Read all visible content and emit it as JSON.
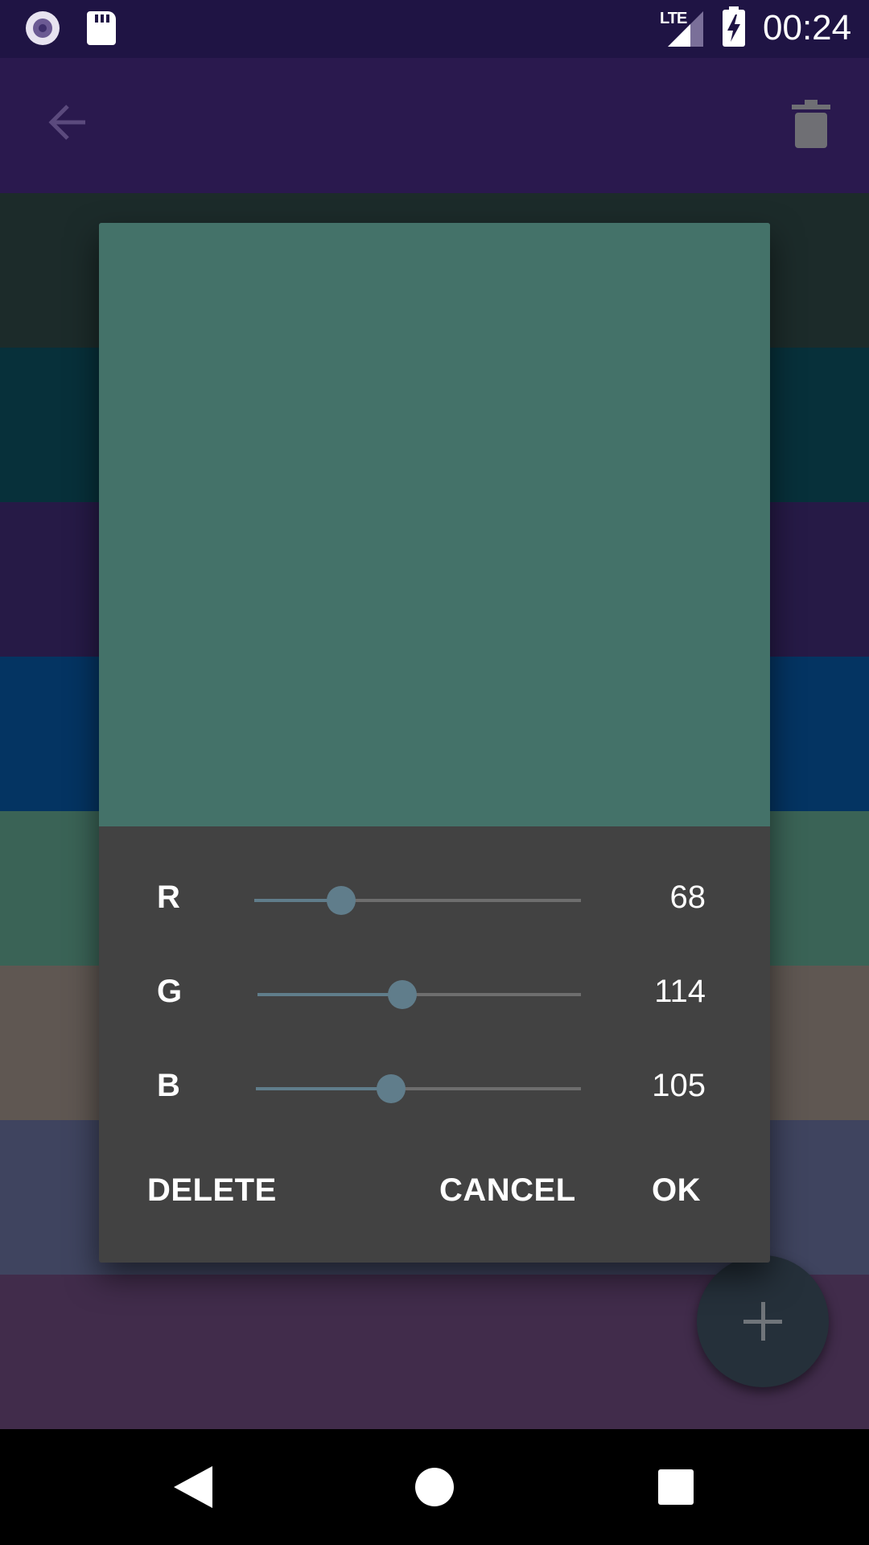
{
  "status_bar": {
    "network": "LTE",
    "time": "00:24"
  },
  "app_bar": {
    "icons": [
      "back-arrow-icon",
      "trash-icon"
    ]
  },
  "background_list": {
    "stripe_colors": [
      "#1c2b2a",
      "#07303a",
      "#261a46",
      "#043462",
      "#3a6356",
      "#5f5752",
      "#3f445f",
      "#412c4b"
    ]
  },
  "dialog": {
    "preview_color": "#447269",
    "sliders": [
      {
        "label": "R",
        "value": "68",
        "fraction": 0.267
      },
      {
        "label": "G",
        "value": "114",
        "fraction": 0.447
      },
      {
        "label": "B",
        "value": "105",
        "fraction": 0.412
      }
    ],
    "buttons": {
      "delete": "DELETE",
      "cancel": "CANCEL",
      "ok": "OK"
    },
    "accent_color": "#607d8b"
  },
  "fab": {
    "icon": "plus-icon"
  },
  "nav_bar": {
    "icons": [
      "nav-back-icon",
      "nav-home-icon",
      "nav-recents-icon"
    ]
  }
}
